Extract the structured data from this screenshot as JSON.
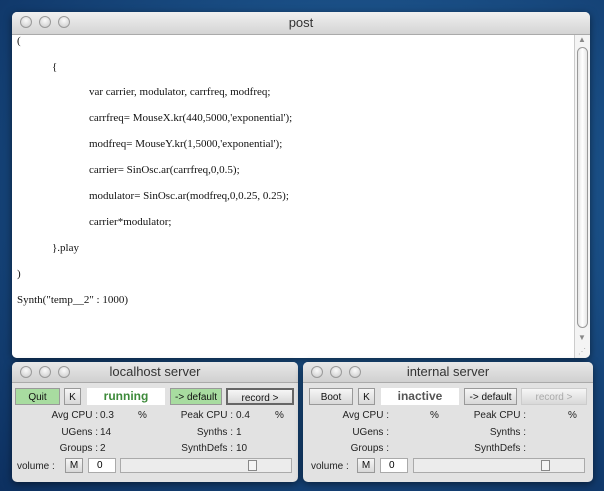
{
  "post": {
    "title": "post",
    "lines": [
      "(",
      "{",
      "var carrier, modulator, carrfreq, modfreq;",
      "carrfreq= MouseX.kr(440,5000,'exponential');",
      "modfreq= MouseY.kr(1,5000,'exponential');",
      "carrier= SinOsc.ar(carrfreq,0,0.5);",
      "modulator= SinOsc.ar(modfreq,0,0.25, 0.25);",
      "carrier*modulator;",
      "}.play",
      ")",
      "Synth(\"temp__2\" : 1000)"
    ]
  },
  "localhost": {
    "title": "localhost server",
    "boot_label": "Quit",
    "k_label": "K",
    "status": "running",
    "default_label": "-> default",
    "record_label": "record >",
    "avg_cpu_label": "Avg CPU :",
    "avg_cpu": "0.3",
    "pct": "%",
    "peak_cpu_label": "Peak CPU :",
    "peak_cpu": "0.4",
    "ugens_label": "UGens :",
    "ugens": "14",
    "synths_label": "Synths :",
    "synths": "1",
    "groups_label": "Groups :",
    "groups": "2",
    "synthdefs_label": "SynthDefs :",
    "synthdefs": "10",
    "volume_label": "volume :",
    "mute_label": "M",
    "volume": "0",
    "volume_slider": 0.8
  },
  "internal": {
    "title": "internal server",
    "boot_label": "Boot",
    "k_label": "K",
    "status": "inactive",
    "default_label": "-> default",
    "record_label": "record >",
    "avg_cpu_label": "Avg CPU :",
    "pct": "%",
    "peak_cpu_label": "Peak CPU :",
    "ugens_label": "UGens :",
    "synths_label": "Synths :",
    "groups_label": "Groups :",
    "synthdefs_label": "SynthDefs :",
    "volume_label": "volume :",
    "mute_label": "M",
    "volume": "0",
    "volume_slider": 0.8
  },
  "colors": {
    "running": "#3d8a3a",
    "inactive": "#555555",
    "green_button": "#a8dca0"
  }
}
